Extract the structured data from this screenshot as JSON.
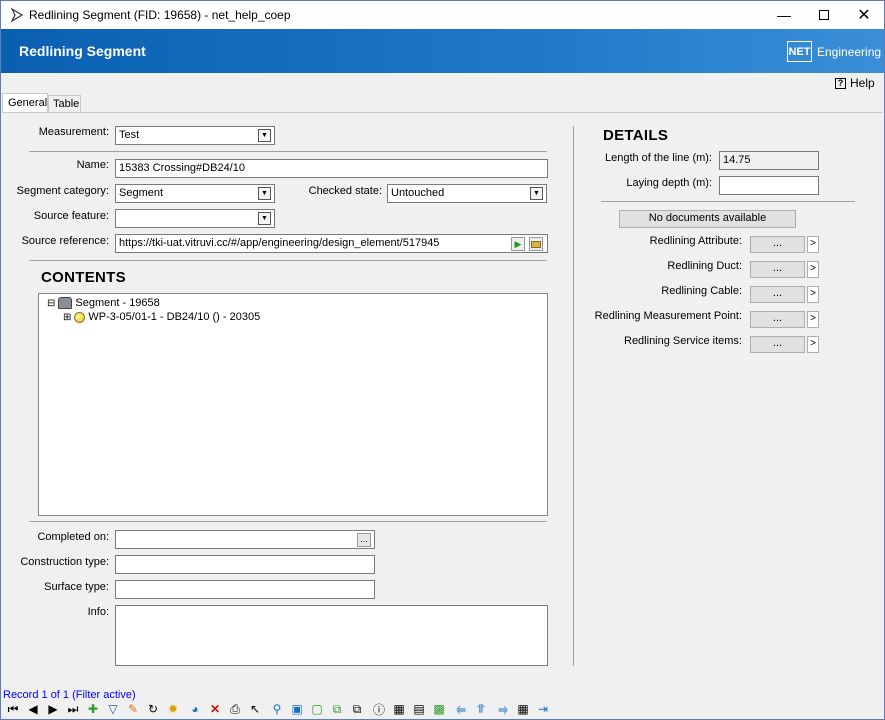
{
  "window": {
    "title": "Redlining Segment (FID: 19658) - net_help_coep"
  },
  "banner": {
    "title": "Redlining Segment",
    "logo_box": "NET",
    "logo_text": "Engineering"
  },
  "help": {
    "label": "Help"
  },
  "tabs": [
    {
      "label": "General"
    },
    {
      "label": "Table"
    }
  ],
  "form": {
    "measurement": {
      "label": "Measurement:",
      "value": "Test"
    },
    "name": {
      "label": "Name:",
      "value": "15383 Crossing#DB24/10"
    },
    "segment_category": {
      "label": "Segment category:",
      "value": "Segment"
    },
    "checked_state": {
      "label": "Checked state:",
      "value": "Untouched"
    },
    "source_feature": {
      "label": "Source feature:",
      "value": ""
    },
    "source_reference": {
      "label": "Source reference:",
      "value": "https://tki-uat.vitruvi.cc/#/app/engineering/design_element/517945"
    }
  },
  "contents": {
    "title": "CONTENTS",
    "tree": [
      {
        "label": "Segment - 19658",
        "expander": "⊟"
      },
      {
        "label": "WP-3-05/01-1 - DB24/10 () - 20305",
        "expander": "⊞"
      }
    ]
  },
  "bottom": {
    "completed_on": {
      "label": "Completed on:",
      "value": "",
      "button": "..."
    },
    "construction_type": {
      "label": "Construction type:",
      "value": ""
    },
    "surface_type": {
      "label": "Surface type:",
      "value": ""
    },
    "info": {
      "label": "Info:",
      "value": ""
    }
  },
  "details": {
    "title": "DETAILS",
    "length": {
      "label": "Length of the line (m):",
      "value": "14.75"
    },
    "laying_depth": {
      "label": "Laying depth (m):",
      "value": ""
    },
    "documents": "No documents available",
    "links": [
      {
        "label": "Redlining Attribute:",
        "button": "...",
        "arrow": ">"
      },
      {
        "label": "Redlining Duct:",
        "button": "...",
        "arrow": ">"
      },
      {
        "label": "Redlining Cable:",
        "button": "...",
        "arrow": ">"
      },
      {
        "label": "Redlining Measurement Point:",
        "button": "...",
        "arrow": ">"
      },
      {
        "label": "Redlining Service items:",
        "button": "...",
        "arrow": ">"
      }
    ]
  },
  "status": {
    "record": "Record 1 of 1 (Filter active)"
  },
  "colors": {
    "banner": "#1f78c8",
    "status_text": "#0000ff"
  }
}
